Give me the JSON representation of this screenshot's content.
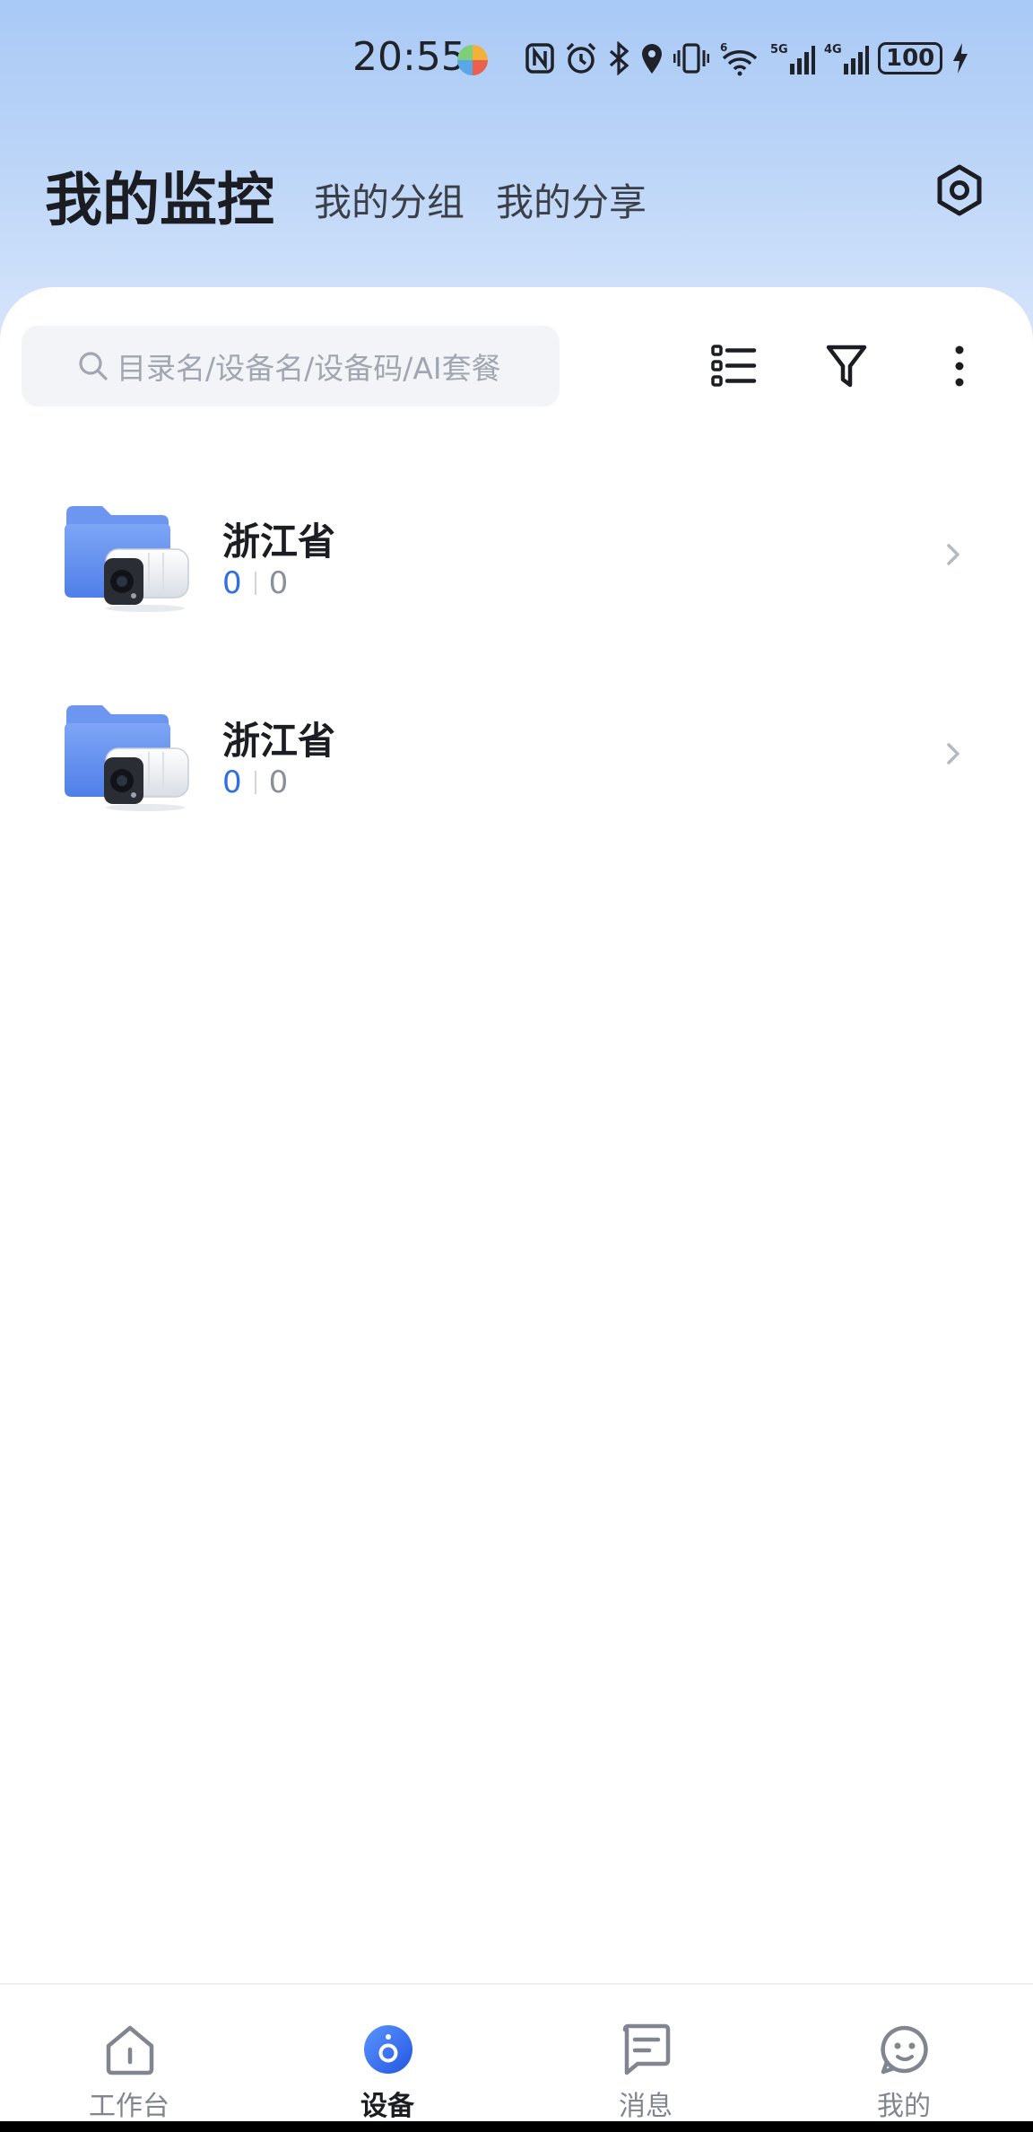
{
  "status_bar": {
    "time": "20:55",
    "app_indicator_icon": "colorful-app-icon",
    "icons": [
      "nfc-icon",
      "alarm-icon",
      "bluetooth-icon",
      "location-icon",
      "vibrate-icon",
      "wifi-icon",
      "signal-5g-icon",
      "signal-4g-icon"
    ],
    "wifi_badge": "6",
    "sim1_label": "5G",
    "sim2_label": "4G",
    "battery": "100",
    "charging_icon": "bolt-icon"
  },
  "header": {
    "title": "我的监控",
    "tabs": [
      {
        "label": "我的分组"
      },
      {
        "label": "我的分享"
      }
    ],
    "settings_icon": "settings-icon"
  },
  "search": {
    "placeholder": "目录名/设备名/设备码/AI套餐",
    "icon": "search-icon"
  },
  "toolbar": {
    "list_view_icon": "list-view-icon",
    "filter_icon": "filter-icon",
    "more_icon": "more-vertical-icon"
  },
  "folders": [
    {
      "name": "浙江省",
      "online": "0",
      "total": "0",
      "icon": "folder-camera-icon"
    },
    {
      "name": "浙江省",
      "online": "0",
      "total": "0",
      "icon": "folder-camera-icon"
    }
  ],
  "bottom_nav": [
    {
      "label": "工作台",
      "icon": "home-icon"
    },
    {
      "label": "设备",
      "icon": "device-icon",
      "active": true
    },
    {
      "label": "消息",
      "icon": "message-icon"
    },
    {
      "label": "我的",
      "icon": "profile-icon"
    }
  ],
  "colors": {
    "accent": "#2f6fe0",
    "header_gradient_top": "#a9c9f6",
    "header_gradient_bottom": "#d9e7fb",
    "search_bg": "#f2f4f7",
    "text_primary": "#1b1d23",
    "text_muted": "#80858f"
  }
}
